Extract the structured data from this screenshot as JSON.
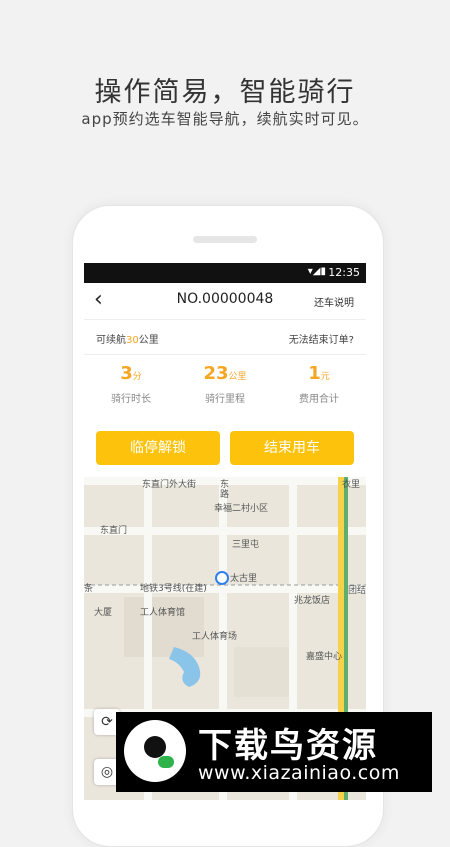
{
  "promo": {
    "headline": "操作简易，智能骑行",
    "subline": "app预约选车智能导航，续航实时可见。"
  },
  "status_bar": {
    "time": "12:35",
    "icons": "▾◢▮"
  },
  "header": {
    "back_icon": "chevron-left-icon",
    "title": "NO.00000048",
    "right_link": "还车说明"
  },
  "range_bar": {
    "prefix": "可续航",
    "value": "30",
    "suffix": "公里",
    "cannot_end": "无法结束订单?"
  },
  "stats": [
    {
      "value": "3",
      "unit": "分",
      "label": "骑行时长"
    },
    {
      "value": "23",
      "unit": "公里",
      "label": "骑行里程"
    },
    {
      "value": "1",
      "unit": "元",
      "label": "费用合计"
    }
  ],
  "buttons": {
    "temp_unlock": "临停解锁",
    "end_ride": "结束用车"
  },
  "map": {
    "labels": {
      "dongzhimen_wai": "东直门外大街",
      "dong": "东",
      "lu": "路",
      "xingfu": "幸福二村小区",
      "dongzhimen": "东直门",
      "sanlitun": "三里屯",
      "line3": "地铁3号线(在建)",
      "taiguli": "太古里",
      "tuanjie": "团结",
      "zhaolong": "兆龙饭店",
      "gongti_stadium": "工人体育馆",
      "gongti_field": "工人体育场",
      "jiayi": "嘉盛中心",
      "yitiao": "条",
      "dasha": "大厦",
      "yi_zhong": "衣里"
    },
    "controls": [
      "refresh-icon",
      "locate-icon"
    ],
    "accent": "#2f80ed"
  },
  "watermark": {
    "title": "下载鸟资源",
    "url": "www.xiazainiao.com"
  },
  "colors": {
    "accent": "#fcc20c",
    "highlight": "#f5a623"
  }
}
